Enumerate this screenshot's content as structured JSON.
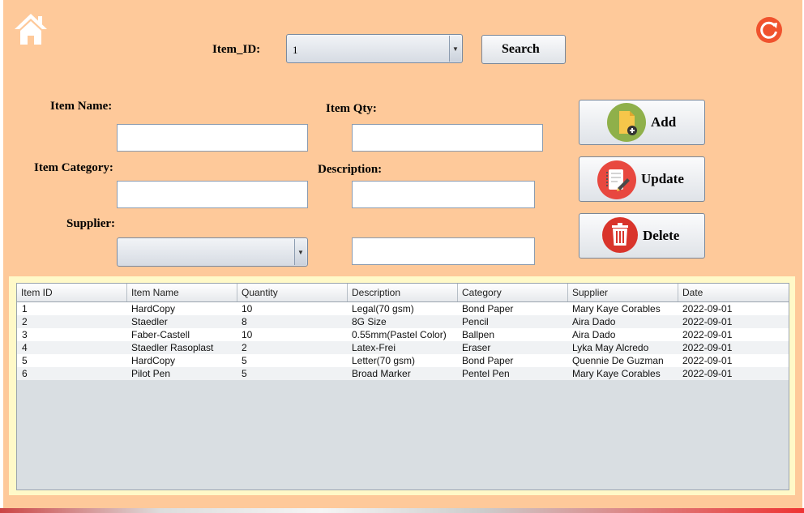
{
  "form": {
    "item_id_label": "Item_ID:",
    "item_id_value": "1",
    "search_label": "Search",
    "item_name_label": "Item Name:",
    "item_qty_label": "Item Qty:",
    "item_category_label": "Item Category:",
    "description_label": "Description:",
    "supplier_label": "Supplier:",
    "supplier_value": ""
  },
  "actions": {
    "add_label": "Add",
    "update_label": "Update",
    "delete_label": "Delete"
  },
  "table": {
    "columns": [
      "Item ID",
      "Item Name",
      "Quantity",
      "Description",
      "Category",
      "Supplier",
      "Date"
    ],
    "rows": [
      [
        "1",
        "HardCopy",
        "10",
        "Legal(70 gsm)",
        "Bond Paper",
        "Mary  Kaye Corables",
        "2022-09-01"
      ],
      [
        "2",
        "Staedler",
        "8",
        "8G Size",
        "Pencil",
        "Aira Dado",
        "2022-09-01"
      ],
      [
        "3",
        "Faber-Castell",
        "10",
        "0.55mm(Pastel Color)",
        "Ballpen",
        "Aira Dado",
        "2022-09-01"
      ],
      [
        "4",
        "Staedler Rasoplast",
        "2",
        "Latex-Frei",
        "Eraser",
        "Lyka May Alcredo",
        "2022-09-01"
      ],
      [
        "5",
        "HardCopy",
        "5",
        "Letter(70 gsm)",
        "Bond Paper",
        "Quennie De Guzman",
        "2022-09-01"
      ],
      [
        "6",
        "Pilot Pen",
        "5",
        "Broad Marker",
        "Pentel Pen",
        "Mary  Kaye Corables",
        "2022-09-01"
      ]
    ]
  },
  "icons": {
    "home": "home-icon",
    "refresh": "refresh-icon",
    "add": "add-file-icon",
    "update": "edit-notebook-icon",
    "delete": "trash-icon"
  },
  "colors": {
    "background": "#fec99a",
    "table_frame": "#fff9c8",
    "refresh_accent": "#f0522d",
    "add_accent": "#8fb04a",
    "update_accent": "#e8483f",
    "delete_accent": "#d9342b"
  }
}
